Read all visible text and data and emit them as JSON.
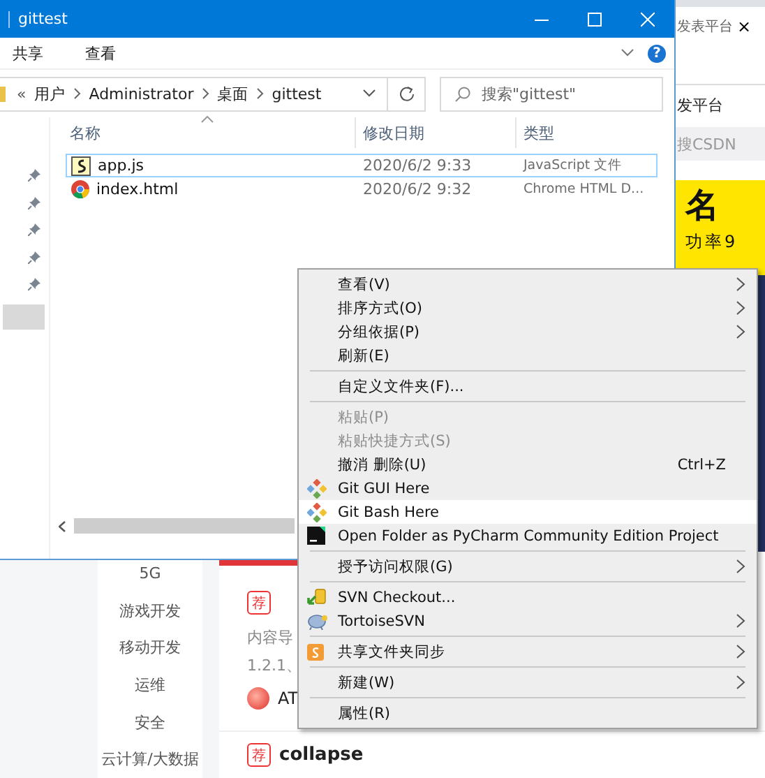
{
  "background_page": {
    "tab_title": "发表平台",
    "tab_close": "×",
    "nav_link": "发平台",
    "search": {
      "placeholder": "搜CSDN"
    },
    "banner": {
      "headline": "名",
      "subline": "功率9"
    },
    "categories": [
      "5G",
      "游戏开发",
      "移动开发",
      "运维",
      "安全",
      "云计算/大数据"
    ],
    "articles": [
      {
        "badge": "荐",
        "excerpt": "内容导",
        "numbering": "1.2.1、",
        "author": "AT"
      },
      {
        "badge": "荐",
        "title": "collapse"
      }
    ]
  },
  "explorer": {
    "title": "gittest",
    "ribbon_tabs": [
      "共享",
      "查看"
    ],
    "help_button": "?",
    "breadcrumb_overflow": "«",
    "breadcrumb": [
      "用户",
      "Administrator",
      "桌面",
      "gittest"
    ],
    "search": {
      "placeholder": "搜索\"gittest\""
    },
    "nav_pane": [
      {
        "pinned": true,
        "selected": false
      },
      {
        "pinned": true,
        "selected": false
      },
      {
        "pinned": true,
        "selected": false
      },
      {
        "pinned": true,
        "selected": false
      },
      {
        "pinned": true,
        "selected": false
      },
      {
        "pinned": false,
        "selected": true
      }
    ],
    "columns": [
      "名称",
      "修改日期",
      "类型"
    ],
    "files": [
      {
        "name": "app.js",
        "modified": "2020/6/2 9:33",
        "type": "JavaScript 文件",
        "kind": "script",
        "focused": true
      },
      {
        "name": "index.html",
        "modified": "2020/6/2 9:32",
        "type": "Chrome HTML D...",
        "kind": "browser",
        "focused": false
      }
    ]
  },
  "context_menu": {
    "items": [
      {
        "kind": "item",
        "label": "查看(V)",
        "submenu": true,
        "disabled": false,
        "highlighted": false
      },
      {
        "kind": "item",
        "label": "排序方式(O)",
        "submenu": true,
        "disabled": false,
        "highlighted": false
      },
      {
        "kind": "item",
        "label": "分组依据(P)",
        "submenu": true,
        "disabled": false,
        "highlighted": false
      },
      {
        "kind": "item",
        "label": "刷新(E)",
        "submenu": false,
        "disabled": false,
        "highlighted": false
      },
      {
        "kind": "separator"
      },
      {
        "kind": "item",
        "label": "自定义文件夹(F)...",
        "submenu": false,
        "disabled": false,
        "highlighted": false
      },
      {
        "kind": "separator"
      },
      {
        "kind": "item",
        "label": "粘贴(P)",
        "submenu": false,
        "disabled": true,
        "highlighted": false
      },
      {
        "kind": "item",
        "label": "粘贴快捷方式(S)",
        "submenu": false,
        "disabled": true,
        "highlighted": false
      },
      {
        "kind": "item",
        "label": "撤消 删除(U)",
        "shortcut": "Ctrl+Z",
        "submenu": false,
        "disabled": false,
        "highlighted": false
      },
      {
        "kind": "git",
        "label": "Git GUI Here",
        "submenu": false,
        "disabled": false,
        "highlighted": false
      },
      {
        "kind": "git",
        "label": "Git Bash Here",
        "submenu": false,
        "disabled": false,
        "highlighted": true
      },
      {
        "kind": "pycharm",
        "label": "Open Folder as PyCharm Community Edition Project",
        "submenu": false,
        "disabled": false,
        "highlighted": false
      },
      {
        "kind": "separator"
      },
      {
        "kind": "item",
        "label": "授予访问权限(G)",
        "submenu": true,
        "disabled": false,
        "highlighted": false
      },
      {
        "kind": "separator"
      },
      {
        "kind": "svn",
        "label": "SVN Checkout...",
        "submenu": false,
        "disabled": false,
        "highlighted": false
      },
      {
        "kind": "tortoise",
        "label": "TortoiseSVN",
        "submenu": true,
        "disabled": false,
        "highlighted": false
      },
      {
        "kind": "separator"
      },
      {
        "kind": "sync",
        "label": "共享文件夹同步",
        "submenu": true,
        "disabled": false,
        "highlighted": false
      },
      {
        "kind": "separator"
      },
      {
        "kind": "item",
        "label": "新建(W)",
        "submenu": true,
        "disabled": false,
        "highlighted": false
      },
      {
        "kind": "separator"
      },
      {
        "kind": "item",
        "label": "属性(R)",
        "submenu": false,
        "disabled": false,
        "highlighted": false
      }
    ]
  }
}
